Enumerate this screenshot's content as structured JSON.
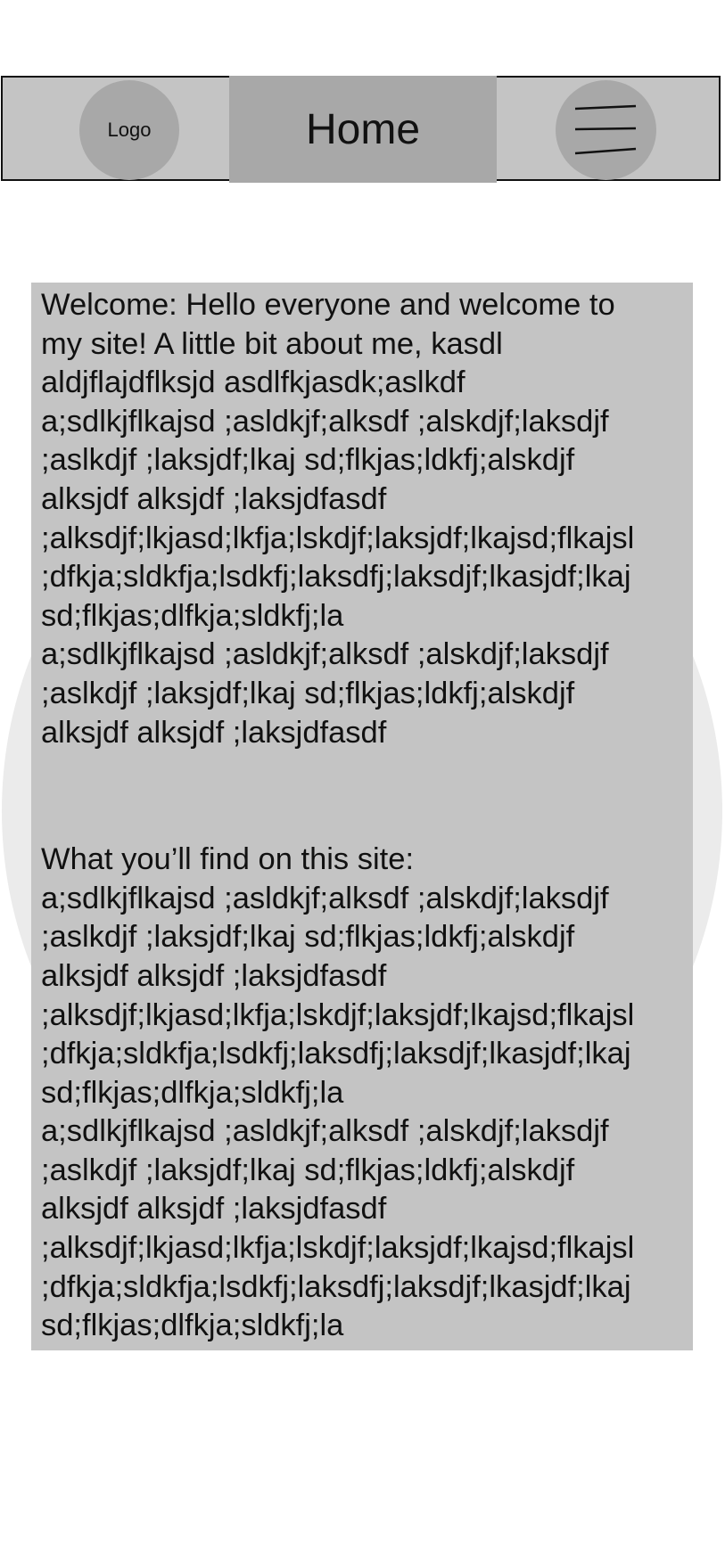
{
  "header": {
    "logo_label": "Logo",
    "title": "Home",
    "menu_icon": "hamburger-menu-icon"
  },
  "content": {
    "welcome_text": "Welcome:  Hello everyone and welcome to\nmy site!  A little bit about me, kasdl\naldjflajdflksjd  asdlfkjasdk;aslkdf\na;sdlkjflkajsd ;asldkjf;alksdf ;alskdjf;laksdjf\n;aslkdjf ;laksjdf;lkaj sd;flkjas;ldkfj;alskdjf\nalksjdf alksjdf ;laksjdfasdf\n;alksdjf;lkjasd;lkfja;lskdjf;laksjdf;lkajsd;flkajsl\n;dfkja;sldkfja;lsdkfj;laksdfj;laksdjf;lkasjdf;lkaj\nsd;flkjas;dlfkja;sldkfj;la\na;sdlkjflkajsd ;asldkjf;alksdf ;alskdjf;laksdjf\n;aslkdjf ;laksjdf;lkaj sd;flkjas;ldkfj;alskdjf\nalksjdf alksjdf ;laksjdfasdf",
    "find_text": "What you’ll find on this site:\na;sdlkjflkajsd ;asldkjf;alksdf ;alskdjf;laksdjf\n;aslkdjf ;laksjdf;lkaj sd;flkjas;ldkfj;alskdjf\nalksjdf alksjdf ;laksjdfasdf\n;alksdjf;lkjasd;lkfja;lskdjf;laksjdf;lkajsd;flkajsl\n;dfkja;sldkfja;lsdkfj;laksdfj;laksdjf;lkasjdf;lkaj\nsd;flkjas;dlfkja;sldkfj;la\na;sdlkjflkajsd ;asldkjf;alksdf ;alskdjf;laksdjf\n;aslkdjf ;laksjdf;lkaj sd;flkjas;ldkfj;alskdjf\nalksjdf alksjdf ;laksjdfasdf\n;alksdjf;lkjasd;lkfja;lskdjf;laksjdf;lkajsd;flkajsl\n;dfkja;sldkfja;lsdkfj;laksdfj;laksdjf;lkasjdf;lkaj\nsd;flkjas;dlfkja;sldkfj;la"
  },
  "colors": {
    "panel": "#c4c4c4",
    "accent": "#a8a8a8",
    "background_circle": "#ebebeb",
    "text": "#111111"
  }
}
